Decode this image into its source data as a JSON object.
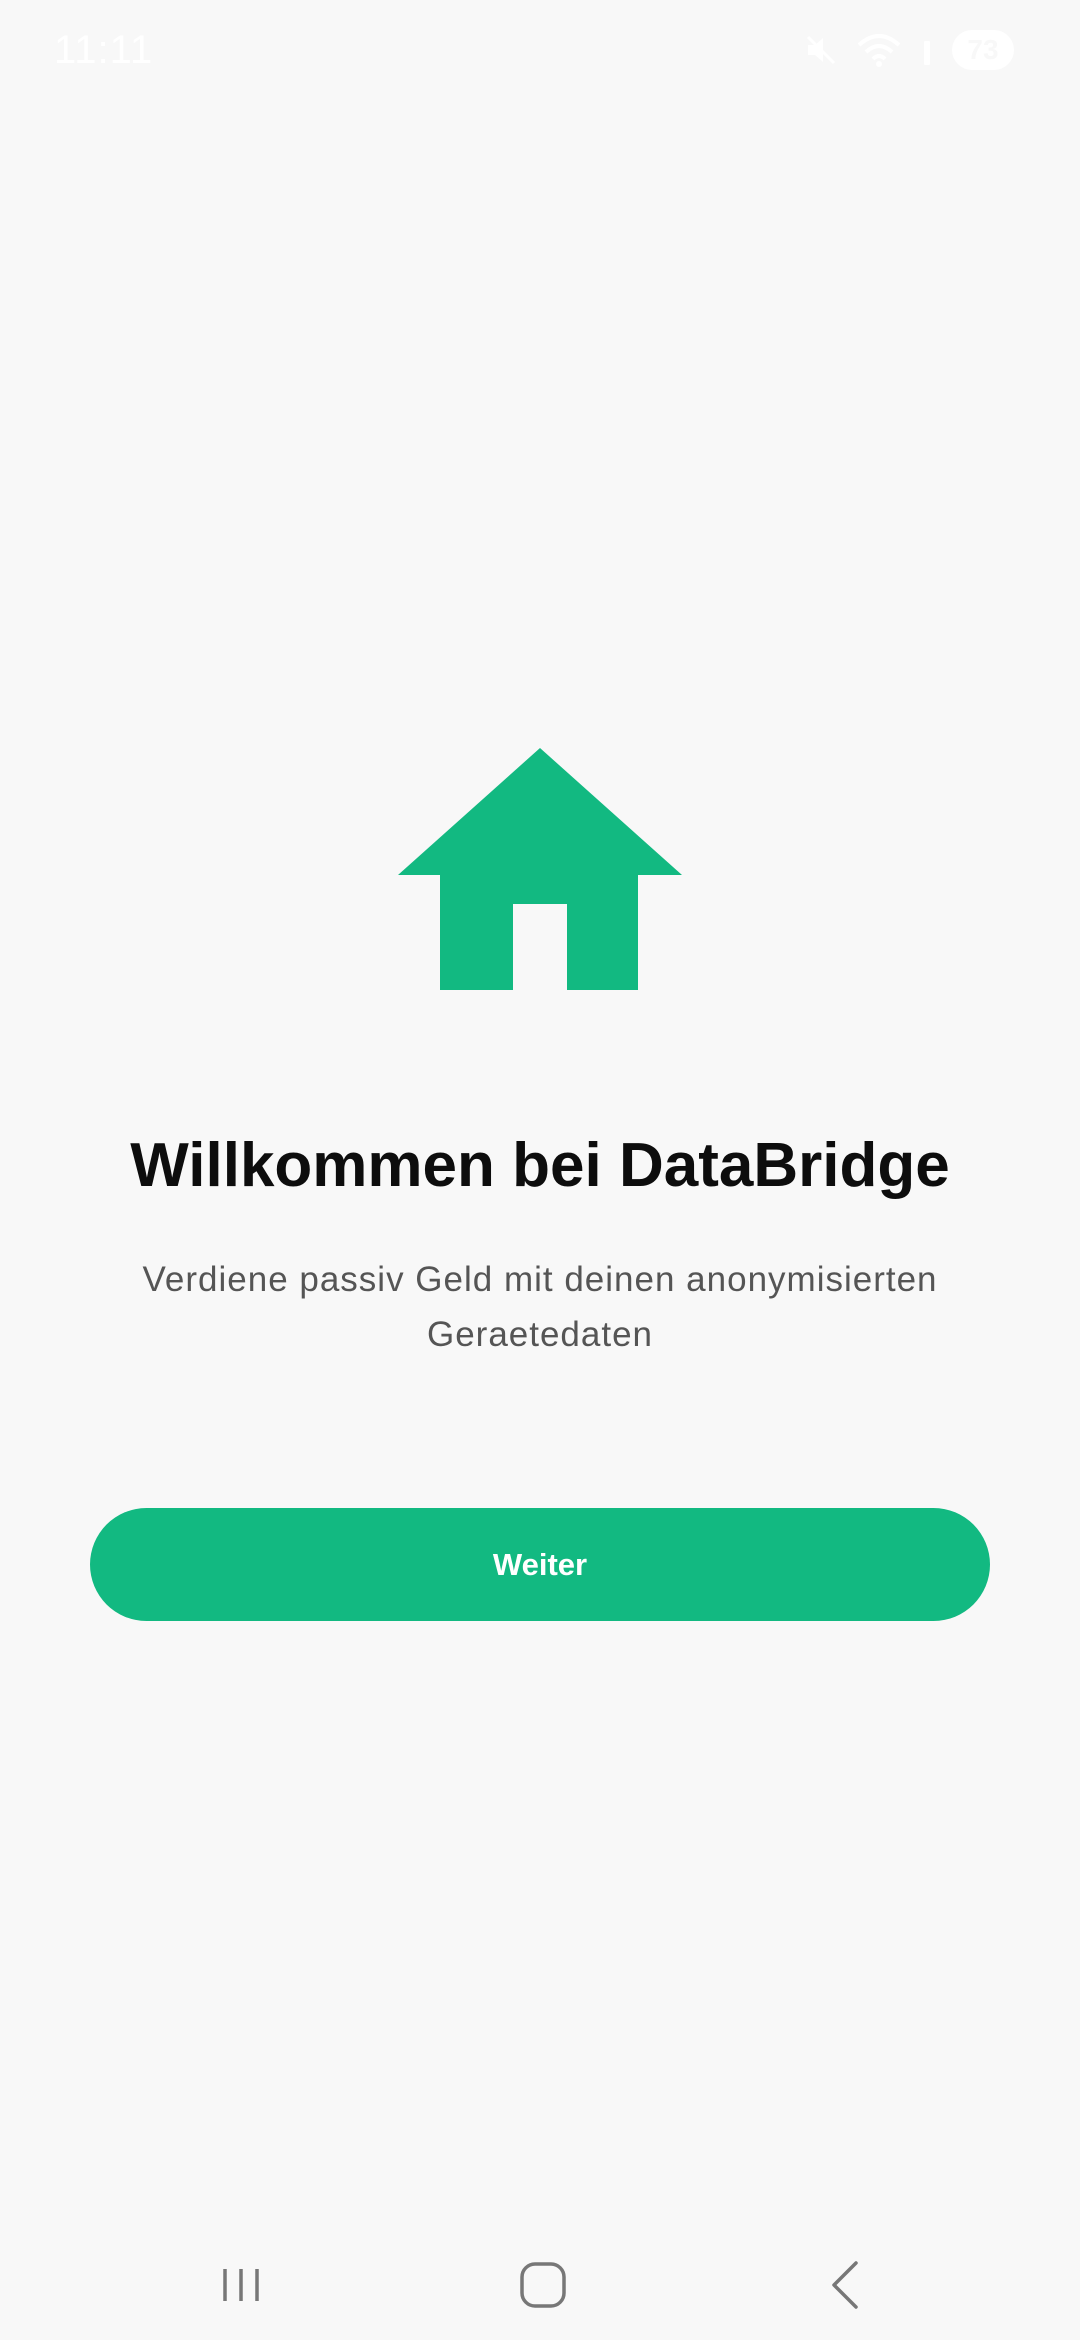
{
  "status_bar": {
    "time": "11:11",
    "icons": [
      "mute-icon",
      "wifi-icon",
      "signal-icon"
    ],
    "battery": "73"
  },
  "welcome": {
    "icon": "home-icon",
    "title": "Willkommen bei DataBridge",
    "subtitle": "Verdiene passiv Geld mit deinen anonymisierten Geraetedaten",
    "button_label": "Weiter"
  },
  "navigation": {
    "icons": [
      "recent-apps-icon",
      "home-button-icon",
      "back-icon"
    ]
  },
  "colors": {
    "accent": "#12b981",
    "background": "#f8f8f8",
    "title": "#0d0d0d",
    "subtitle": "#555555"
  }
}
